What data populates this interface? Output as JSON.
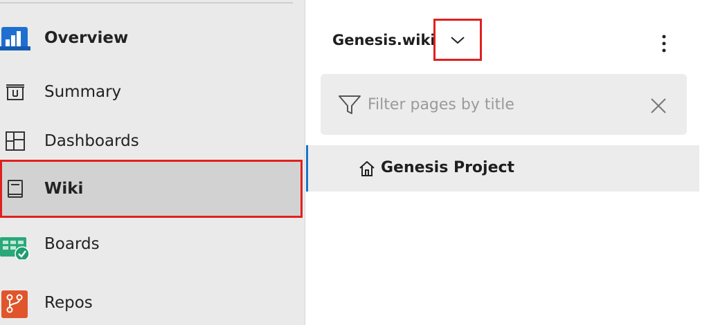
{
  "sidebar": {
    "items": [
      {
        "label": "Overview",
        "icon": "overview-icon"
      },
      {
        "label": "Summary",
        "icon": "summary-icon"
      },
      {
        "label": "Dashboards",
        "icon": "dashboards-icon"
      },
      {
        "label": "Wiki",
        "icon": "wiki-icon"
      },
      {
        "label": "Boards",
        "icon": "boards-icon"
      },
      {
        "label": "Repos",
        "icon": "repos-icon"
      }
    ]
  },
  "wiki": {
    "title": "Genesis.wiki",
    "filter_placeholder": "Filter pages by title",
    "pages": [
      {
        "label": "Genesis Project",
        "icon": "home-icon"
      }
    ]
  },
  "colors": {
    "highlight": "#e0201e",
    "selection_bar": "#1a74c9",
    "overview_blue": "#1f6fd1",
    "boards_green": "#2aa87a",
    "repos_orange": "#e0552b"
  }
}
